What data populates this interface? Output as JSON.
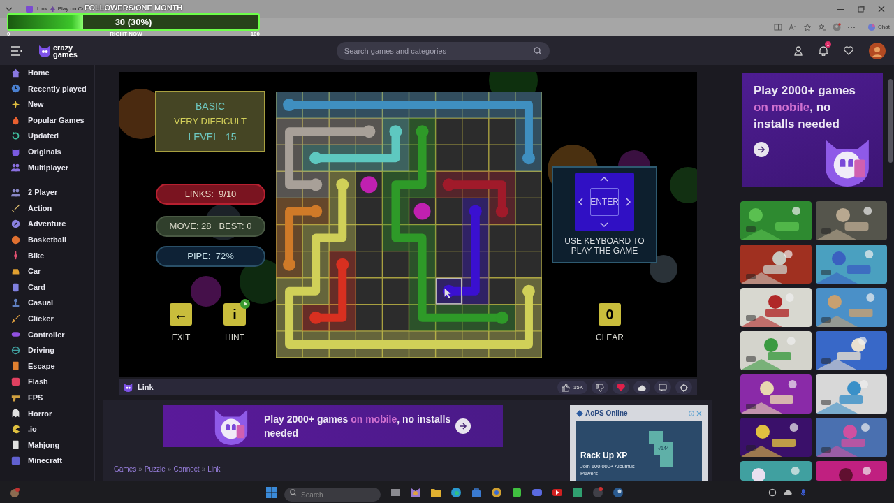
{
  "browser": {
    "tab_title": "Link",
    "tab_subtitle": "Play on Cr",
    "assistant_label": "Chat"
  },
  "stream_overlay": {
    "title": "FOLLOWERS/ONE MONTH",
    "reading": "30 (30%)",
    "level": 0.3,
    "min_label": "0",
    "marker_label": "RIGHT NOW",
    "max_label": "100"
  },
  "site_header": {
    "logo_line1": "crazy",
    "logo_line2": "games",
    "search": {
      "placeholder": "Search games and categories"
    },
    "notification_count": "1"
  },
  "sidebar": {
    "groups": [
      [
        {
          "label": "Home"
        },
        {
          "label": "Recently played"
        },
        {
          "label": "New"
        },
        {
          "label": "Popular Games"
        },
        {
          "label": "Updated"
        },
        {
          "label": "Originals"
        },
        {
          "label": "Multiplayer"
        }
      ],
      [
        {
          "label": "2 Player"
        },
        {
          "label": "Action"
        },
        {
          "label": "Adventure"
        },
        {
          "label": "Basketball"
        },
        {
          "label": "Bike"
        },
        {
          "label": "Car"
        },
        {
          "label": "Card"
        },
        {
          "label": "Casual"
        },
        {
          "label": "Clicker"
        },
        {
          "label": "Controller"
        },
        {
          "label": "Driving"
        },
        {
          "label": "Escape"
        },
        {
          "label": "Flash"
        },
        {
          "label": "FPS"
        },
        {
          "label": "Horror"
        },
        {
          "label": ".io"
        },
        {
          "label": "Mahjong"
        },
        {
          "label": "Minecraft"
        }
      ]
    ]
  },
  "game": {
    "mode": "BASIC",
    "difficulty": "VERY DIFFICULT",
    "level_label": "LEVEL",
    "level_value": "15",
    "links": "LINKS:  9/10",
    "moves": "MOVE: 28   BEST: 0",
    "pipe": "PIPE:  72%",
    "exit_button": {
      "glyph": "←",
      "label": "EXIT"
    },
    "hint_button": {
      "glyph": "i",
      "label": "HINT"
    },
    "clear_button": {
      "glyph": "0",
      "label": "CLEAR"
    },
    "keyboard_hint": {
      "key_label": "ENTER",
      "caption": "USE KEYBOARD TO PLAY THE GAME"
    }
  },
  "game_bar": {
    "title": "Link",
    "likes": "15K",
    "favorited": true
  },
  "side_promo": {
    "before": "Play 2000+ games ",
    "highlight": "on mobile",
    "after": ", no installs needed"
  },
  "bottom_promo": {
    "before": "Play 2000+ games ",
    "highlight": "on mobile",
    "after": ", no installs needed"
  },
  "ad": {
    "brand": "AoPS Online",
    "headline": "Rack Up XP",
    "body": "Join 100,000+ Alcumus Players",
    "tile": "√144"
  },
  "breadcrumbs": {
    "items": [
      "Games",
      "Puzzle",
      "Connect",
      "Link"
    ],
    "separator": "»"
  },
  "taskbar": {
    "search": {
      "placeholder": "Search"
    }
  }
}
